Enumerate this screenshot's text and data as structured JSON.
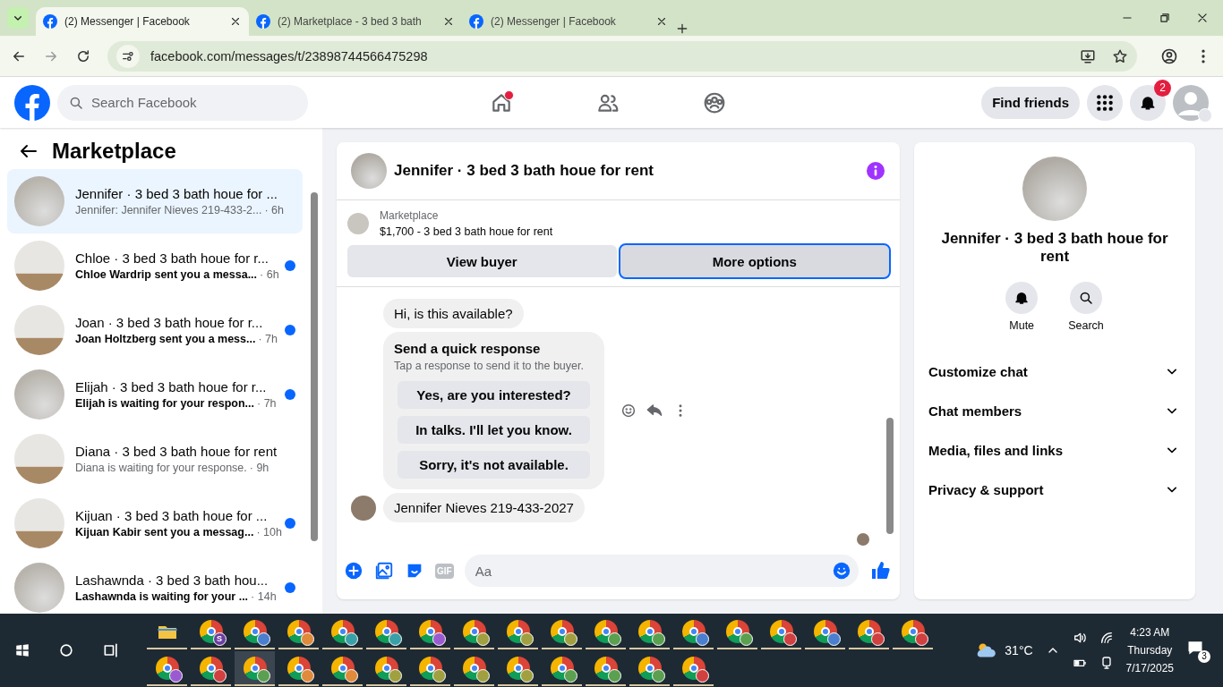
{
  "browser": {
    "tabs": [
      {
        "title": "(2) Messenger | Facebook",
        "selected": true
      },
      {
        "title": "(2) Marketplace - 3 bed 3 bath",
        "selected": false
      },
      {
        "title": "(2) Messenger | Facebook",
        "selected": false
      }
    ],
    "url": "facebook.com/messages/t/23898744566475298"
  },
  "header": {
    "search": {
      "placeholder": "Search Facebook"
    },
    "nav": [
      {
        "kind": "home",
        "dot": true
      },
      {
        "kind": "friends",
        "dot": false
      },
      {
        "kind": "groups",
        "dot": false
      }
    ],
    "find_friends": "Find friends",
    "notification_count": "2"
  },
  "sidebar": {
    "title": "Marketplace",
    "conversations": [
      {
        "title": "Jennifer · 3 bed 3 bath houe for ...",
        "preview": "Jennifer: Jennifer Nieves 219-433-2...",
        "time": "· 6h",
        "selected": true,
        "unread": false
      },
      {
        "title": "Chloe · 3 bed 3 bath houe for r...",
        "preview": "Chloe Wardrip sent you a messa...",
        "time": "· 6h",
        "selected": false,
        "unread": true
      },
      {
        "title": "Joan · 3 bed 3 bath houe for r...",
        "preview": "Joan Holtzberg sent you a mess...",
        "time": "· 7h",
        "selected": false,
        "unread": true
      },
      {
        "title": "Elijah · 3 bed 3 bath houe for r...",
        "preview": "Elijah is waiting for your respon...",
        "time": "· 7h",
        "selected": false,
        "unread": true
      },
      {
        "title": "Diana · 3 bed 3 bath houe for rent",
        "preview": "Diana is waiting for your response.",
        "time": "· 9h",
        "selected": false,
        "unread": false
      },
      {
        "title": "Kijuan · 3 bed 3 bath houe for ...",
        "preview": "Kijuan Kabir sent you a messag...",
        "time": "· 10h",
        "selected": false,
        "unread": true
      },
      {
        "title": "Lashawnda · 3 bed 3 bath hou...",
        "preview": "Lashawnda is waiting for your ...",
        "time": "· 14h",
        "selected": false,
        "unread": true
      }
    ]
  },
  "chat": {
    "title": "Jennifer · 3 bed 3 bath houe for rent",
    "listing": {
      "source": "Marketplace",
      "summary": "$1,700 - 3 bed 3 bath houe for rent"
    },
    "buttons": [
      {
        "label": "View buyer",
        "focused": false
      },
      {
        "label": "More options",
        "focused": true
      }
    ],
    "messages": [
      {
        "kind": "text",
        "text": "Hi, is this available?",
        "avatar": false
      },
      {
        "kind": "quick_response",
        "title": "Send a quick response",
        "subtitle": "Tap a response to send it to the buyer.",
        "options": [
          "Yes, are you interested?",
          "In talks. I'll let you know.",
          "Sorry, it's not available."
        ]
      },
      {
        "kind": "text",
        "text": "Jennifer Nieves 219-433-2027",
        "avatar": true
      }
    ],
    "composer": {
      "placeholder": "Aa",
      "gif_label": "GIF"
    }
  },
  "details": {
    "name": "Jennifer · 3 bed 3 bath houe for rent",
    "actions": [
      {
        "kind": "mute",
        "label": "Mute"
      },
      {
        "kind": "search",
        "label": "Search"
      }
    ],
    "sections": [
      {
        "label": "Customize chat",
        "expanded": false
      },
      {
        "label": "Chat members",
        "expanded": false
      },
      {
        "label": "Media, files and links",
        "expanded": false
      },
      {
        "label": "Privacy & support",
        "expanded": false
      }
    ]
  },
  "taskbar": {
    "apps": [
      {
        "kind": "folder",
        "selected": false
      },
      {
        "kind": "browser",
        "color": "#6b3fa0",
        "badge": "S",
        "selected": false
      },
      {
        "kind": "browser",
        "color": "#4a7fd0",
        "selected": false
      },
      {
        "kind": "browser",
        "color": "#e08a3c",
        "selected": false
      },
      {
        "kind": "browser",
        "color": "#3aa0a8",
        "selected": false
      },
      {
        "kind": "browser",
        "color": "#3aa0a8",
        "selected": false
      },
      {
        "kind": "browser",
        "color": "#9a5bd0",
        "selected": false
      },
      {
        "kind": "browser",
        "color": "#a0a040",
        "selected": false
      },
      {
        "kind": "browser",
        "color": "#a0a040",
        "selected": false
      },
      {
        "kind": "browser",
        "color": "#a0a040",
        "selected": false
      },
      {
        "kind": "browser",
        "color": "#5aa050",
        "selected": false
      },
      {
        "kind": "browser",
        "color": "#5aa050",
        "selected": false
      },
      {
        "kind": "browser",
        "color": "#4a7fd0",
        "selected": false
      },
      {
        "kind": "browser",
        "color": "#5aa050",
        "selected": false
      },
      {
        "kind": "browser",
        "color": "#d04040",
        "selected": false
      },
      {
        "kind": "browser",
        "color": "#4a7fd0",
        "selected": false
      },
      {
        "kind": "browser",
        "color": "#d04040",
        "selected": false
      },
      {
        "kind": "browser",
        "color": "#d04040",
        "selected": false
      },
      {
        "kind": "browser",
        "color": "#9a5bd0",
        "selected": false
      },
      {
        "kind": "browser",
        "color": "#d04040",
        "selected": false
      },
      {
        "kind": "browser",
        "color": "#5aa050",
        "selected": true
      },
      {
        "kind": "browser",
        "color": "#e08a3c",
        "selected": false
      },
      {
        "kind": "browser",
        "color": "#e08a3c",
        "selected": false
      },
      {
        "kind": "browser",
        "color": "#a0a040",
        "selected": false
      },
      {
        "kind": "browser",
        "color": "#a0a040",
        "selected": false
      },
      {
        "kind": "browser",
        "color": "#a0a040",
        "selected": false
      },
      {
        "kind": "browser",
        "color": "#a0a040",
        "selected": false
      },
      {
        "kind": "browser",
        "color": "#5aa050",
        "selected": false
      },
      {
        "kind": "browser",
        "color": "#5aa050",
        "selected": false
      },
      {
        "kind": "browser",
        "color": "#5aa050",
        "selected": false
      },
      {
        "kind": "browser",
        "color": "#d04040",
        "selected": false
      }
    ],
    "weather": "31°C",
    "time": "4:23 AM",
    "day": "Thursday",
    "date": "7/17/2025",
    "notification_count": "3"
  }
}
